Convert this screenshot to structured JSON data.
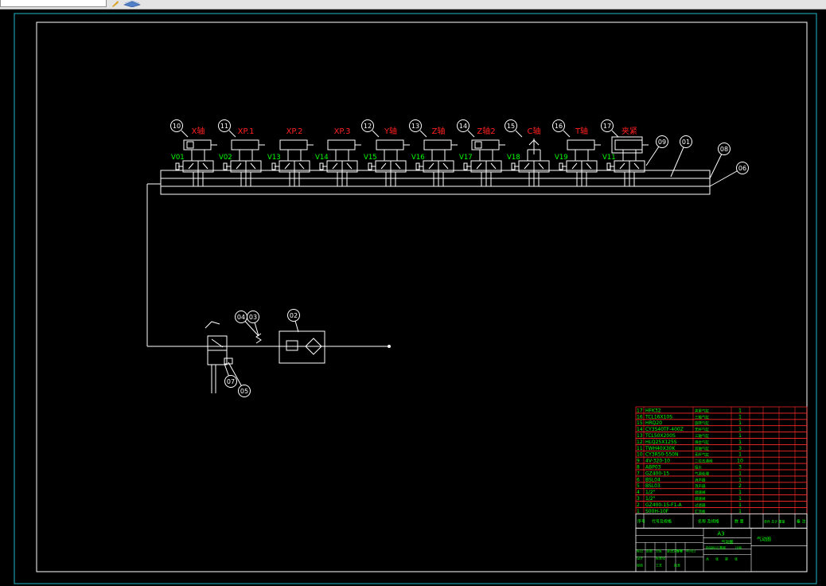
{
  "window": {
    "chrome_visible": true
  },
  "colors": {
    "background": "#000000",
    "border_outer": "#1fb6c8",
    "border_inner": "#ffffff",
    "lines": "#ffffff",
    "label_red": "#ff2020",
    "label_green": "#00ff00",
    "table_red": "#ff2a2a"
  },
  "diagram": {
    "actuator_labels": [
      "X轴",
      "XP.1",
      "XP.2",
      "XP.3",
      "Y轴",
      "Z轴",
      "Z轴2",
      "C轴",
      "T轴",
      "夹紧"
    ],
    "valve_labels": [
      "V01",
      "V02",
      "V13",
      "V14",
      "V15",
      "V16",
      "V17",
      "V18",
      "V19",
      "V11"
    ],
    "callouts": [
      "10",
      "11",
      "12",
      "13",
      "14",
      "15",
      "16",
      "17",
      "09",
      "01",
      "08",
      "06",
      "04",
      "03",
      "02",
      "07",
      "05"
    ]
  },
  "bom": {
    "rows": [
      {
        "no": "17",
        "code": "HFK32",
        "name": "夹紧气缸",
        "qty": "1"
      },
      {
        "no": "16",
        "code": "TCL16X10S",
        "name": "三轴气缸",
        "qty": "1"
      },
      {
        "no": "15",
        "code": "HRQ20",
        "name": "旋转气缸",
        "qty": "1"
      },
      {
        "no": "14",
        "code": "CY3S40TF-400Z",
        "name": "无杆气缸",
        "qty": "1"
      },
      {
        "no": "13",
        "code": "TCL50X200S",
        "name": "三轴气缸",
        "qty": "1"
      },
      {
        "no": "12",
        "code": "HLQ25X125S",
        "name": "滑台气缸",
        "qty": "1"
      },
      {
        "no": "11",
        "code": "TWH40X30K",
        "name": "双轴气缸",
        "qty": "3"
      },
      {
        "no": "10",
        "code": "CY3R50-550N",
        "name": "无杆气缸",
        "qty": "1"
      },
      {
        "no": "9",
        "code": "4V-320-10",
        "name": "二位五通阀",
        "qty": "10"
      },
      {
        "no": "8",
        "code": "ABP03",
        "name": "接头",
        "qty": "3"
      },
      {
        "no": "7",
        "code": "GZ400-15",
        "name": "气源处理",
        "qty": "1"
      },
      {
        "no": "6",
        "code": "BSL04",
        "name": "消声器",
        "qty": "1"
      },
      {
        "no": "5",
        "code": "BSL03",
        "name": "消声器",
        "qty": "2"
      },
      {
        "no": "4",
        "code": "1/2\"",
        "name": "调速阀",
        "qty": "1"
      },
      {
        "no": "3",
        "code": "1/2\"",
        "name": "调速阀",
        "qty": "1"
      },
      {
        "no": "2",
        "code": "GZ400-15-F1-A",
        "name": "过滤器",
        "qty": "1"
      },
      {
        "no": "1",
        "code": "S00H-10F",
        "name": "汇流板",
        "qty": "1"
      }
    ],
    "header": {
      "no": "序号",
      "code": "代号及规格",
      "name": "名称 及规格",
      "qty": "数 量",
      "material": "材料",
      "weight": "单件 总计 重量",
      "remark": "备 注"
    }
  },
  "title_block": {
    "scale": "A3",
    "label": "气动图",
    "drawing_name": "气动图",
    "cells": [
      "标记",
      "处数",
      "分区",
      "更改文件号",
      "签名",
      "年月日",
      "设计",
      "标准化",
      "阶段标记",
      "重量",
      "比例",
      "审核",
      "工艺",
      "批准",
      "共",
      "张",
      "第",
      "张"
    ]
  }
}
